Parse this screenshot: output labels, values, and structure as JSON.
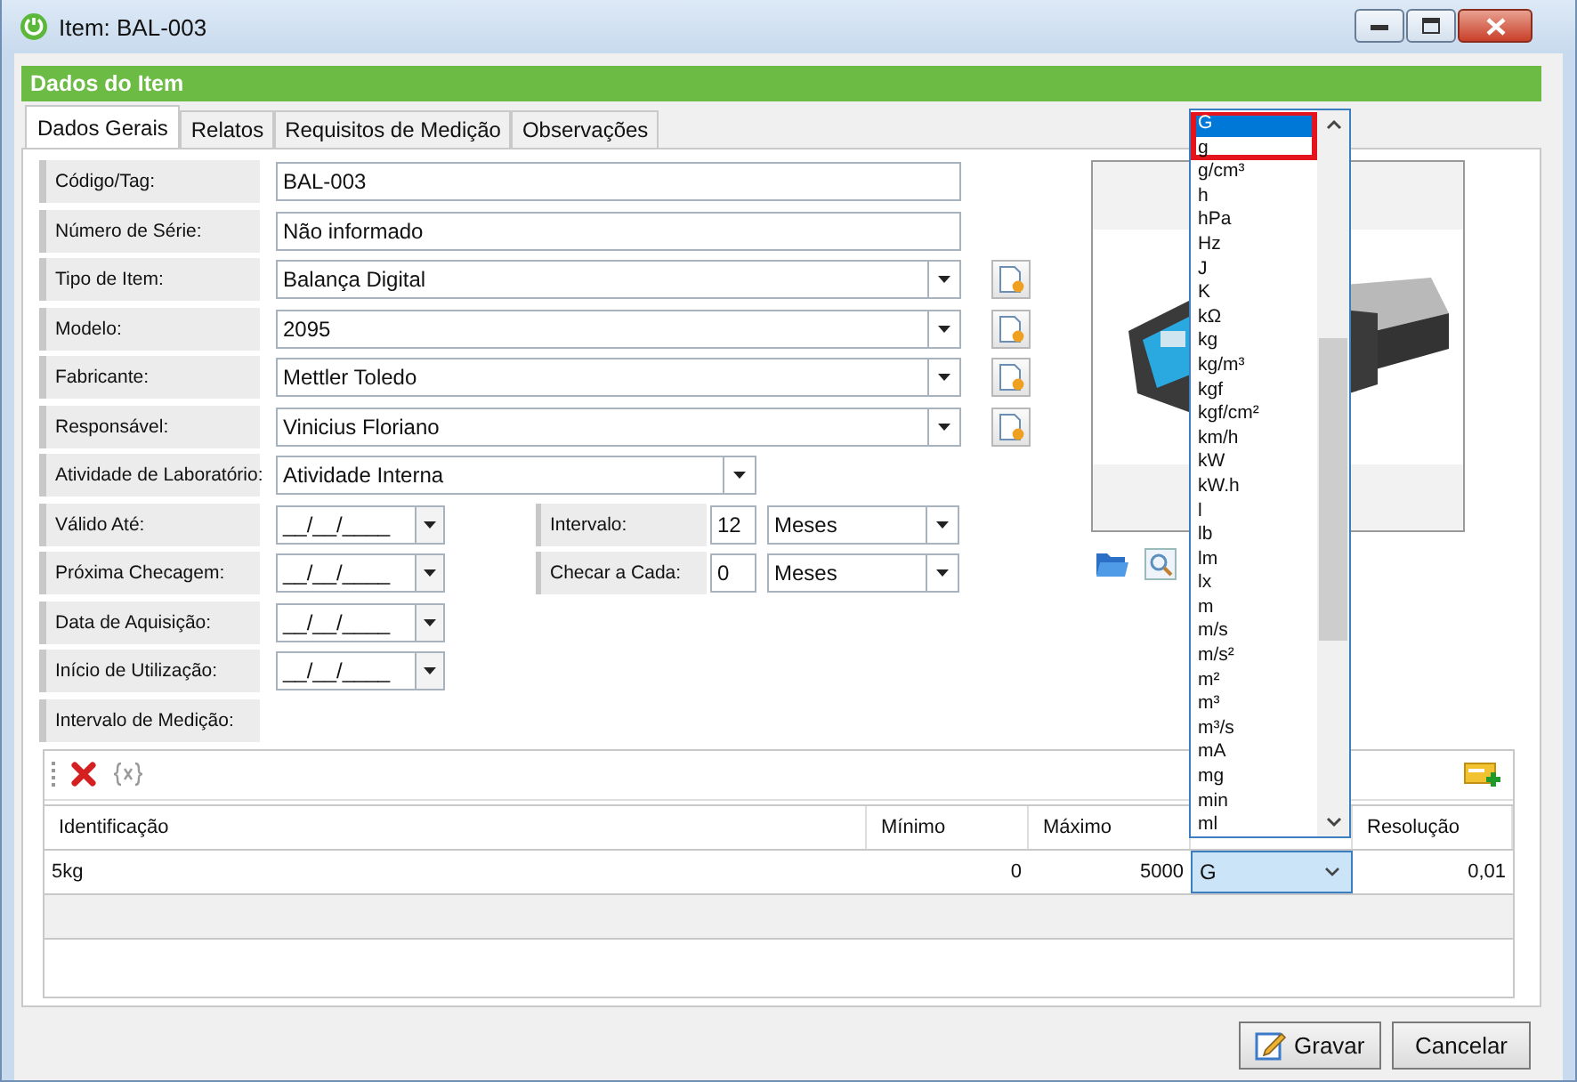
{
  "window": {
    "title": "Item: BAL-003"
  },
  "section_header": "Dados do Item",
  "tabs": [
    {
      "label": "Dados Gerais",
      "selected": true
    },
    {
      "label": "Relatos",
      "selected": false
    },
    {
      "label": "Requisitos de Medição",
      "selected": false
    },
    {
      "label": "Observações",
      "selected": false
    }
  ],
  "fields": [
    {
      "kind": "text",
      "label": "Código/Tag:",
      "value": "BAL-003"
    },
    {
      "kind": "text",
      "label": "Número de Série:",
      "value": "Não informado"
    },
    {
      "kind": "combo",
      "label": "Tipo de Item:",
      "value": "Balança Digital",
      "add_button": true
    },
    {
      "kind": "combo",
      "label": "Modelo:",
      "value": "2095",
      "add_button": true
    },
    {
      "kind": "combo",
      "label": "Fabricante:",
      "value": "Mettler Toledo",
      "add_button": true
    },
    {
      "kind": "combo",
      "label": "Responsável:",
      "value": "Vinicius Floriano",
      "add_button": true
    },
    {
      "kind": "combo",
      "label": "Atividade de Laboratório:",
      "value": "Atividade Interna",
      "add_button": false
    },
    {
      "kind": "date",
      "label": "Válido Até:",
      "value": "__/__/____",
      "interval": {
        "label": "Intervalo:",
        "value": "12",
        "unit": "Meses"
      }
    },
    {
      "kind": "date",
      "label": "Próxima Checagem:",
      "value": "__/__/____",
      "interval": {
        "label": "Checar a Cada:",
        "value": "0",
        "unit": "Meses"
      }
    },
    {
      "kind": "date",
      "label": "Data de Aquisição:",
      "value": "__/__/____"
    },
    {
      "kind": "date",
      "label": "Início de Utilização:",
      "value": "__/__/____"
    },
    {
      "kind": "heading",
      "label": "Intervalo de Medição:"
    }
  ],
  "measurement_grid": {
    "columns": [
      "Identificação",
      "Mínimo",
      "Máximo",
      "Resolução"
    ],
    "rows": [
      {
        "identification": "5kg",
        "minimum": "0",
        "maximum": "5000",
        "unit": "G",
        "resolution": "0,01"
      }
    ]
  },
  "unit_dropdown": {
    "items": [
      {
        "label": "G",
        "selected": true,
        "highlighted": true
      },
      {
        "label": "g",
        "selected": false,
        "highlighted": true
      },
      {
        "label": "g/cm³",
        "selected": false,
        "highlighted": false
      },
      {
        "label": "h",
        "selected": false,
        "highlighted": false
      },
      {
        "label": "hPa",
        "selected": false,
        "highlighted": false
      },
      {
        "label": "Hz",
        "selected": false,
        "highlighted": false
      },
      {
        "label": "J",
        "selected": false,
        "highlighted": false
      },
      {
        "label": "K",
        "selected": false,
        "highlighted": false
      },
      {
        "label": "kΩ",
        "selected": false,
        "highlighted": false
      },
      {
        "label": "kg",
        "selected": false,
        "highlighted": false
      },
      {
        "label": "kg/m³",
        "selected": false,
        "highlighted": false
      },
      {
        "label": "kgf",
        "selected": false,
        "highlighted": false
      },
      {
        "label": "kgf/cm²",
        "selected": false,
        "highlighted": false
      },
      {
        "label": "km/h",
        "selected": false,
        "highlighted": false
      },
      {
        "label": "kW",
        "selected": false,
        "highlighted": false
      },
      {
        "label": "kW.h",
        "selected": false,
        "highlighted": false
      },
      {
        "label": "l",
        "selected": false,
        "highlighted": false
      },
      {
        "label": "lb",
        "selected": false,
        "highlighted": false
      },
      {
        "label": "lm",
        "selected": false,
        "highlighted": false
      },
      {
        "label": "lx",
        "selected": false,
        "highlighted": false
      },
      {
        "label": "m",
        "selected": false,
        "highlighted": false
      },
      {
        "label": "m/s",
        "selected": false,
        "highlighted": false
      },
      {
        "label": "m/s²",
        "selected": false,
        "highlighted": false
      },
      {
        "label": "m²",
        "selected": false,
        "highlighted": false
      },
      {
        "label": "m³",
        "selected": false,
        "highlighted": false
      },
      {
        "label": "m³/s",
        "selected": false,
        "highlighted": false
      },
      {
        "label": "mA",
        "selected": false,
        "highlighted": false
      },
      {
        "label": "mg",
        "selected": false,
        "highlighted": false
      },
      {
        "label": "min",
        "selected": false,
        "highlighted": false
      },
      {
        "label": "ml",
        "selected": false,
        "highlighted": false
      }
    ]
  },
  "buttons": [
    {
      "kind": "save",
      "label": "Gravar"
    },
    {
      "kind": "cancel",
      "label": "Cancelar"
    }
  ]
}
